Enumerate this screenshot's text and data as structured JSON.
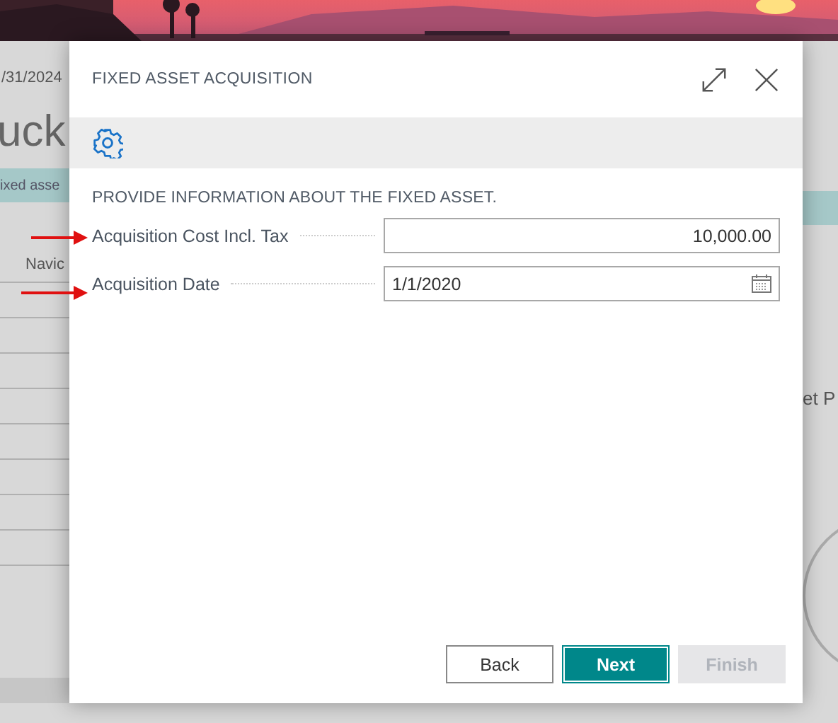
{
  "background_page": {
    "date": "/31/2024",
    "title": "uck",
    "banner": "ixed asse",
    "nav_label": "Navic",
    "side_heading": "et P"
  },
  "dialog": {
    "title": "FIXED ASSET ACQUISITION",
    "section_heading": "PROVIDE INFORMATION ABOUT THE FIXED ASSET.",
    "fields": [
      {
        "label": "Acquisition Cost Incl. Tax",
        "value": "10,000.00",
        "kind": "number",
        "annotated": true
      },
      {
        "label": "Acquisition Date",
        "value": "1/1/2020",
        "kind": "date",
        "annotated": true
      }
    ],
    "buttons": [
      {
        "label": "Back",
        "kind": "default",
        "disabled": false
      },
      {
        "label": "Next",
        "kind": "primary",
        "disabled": false
      },
      {
        "label": "Finish",
        "kind": "default",
        "disabled": true
      }
    ]
  }
}
